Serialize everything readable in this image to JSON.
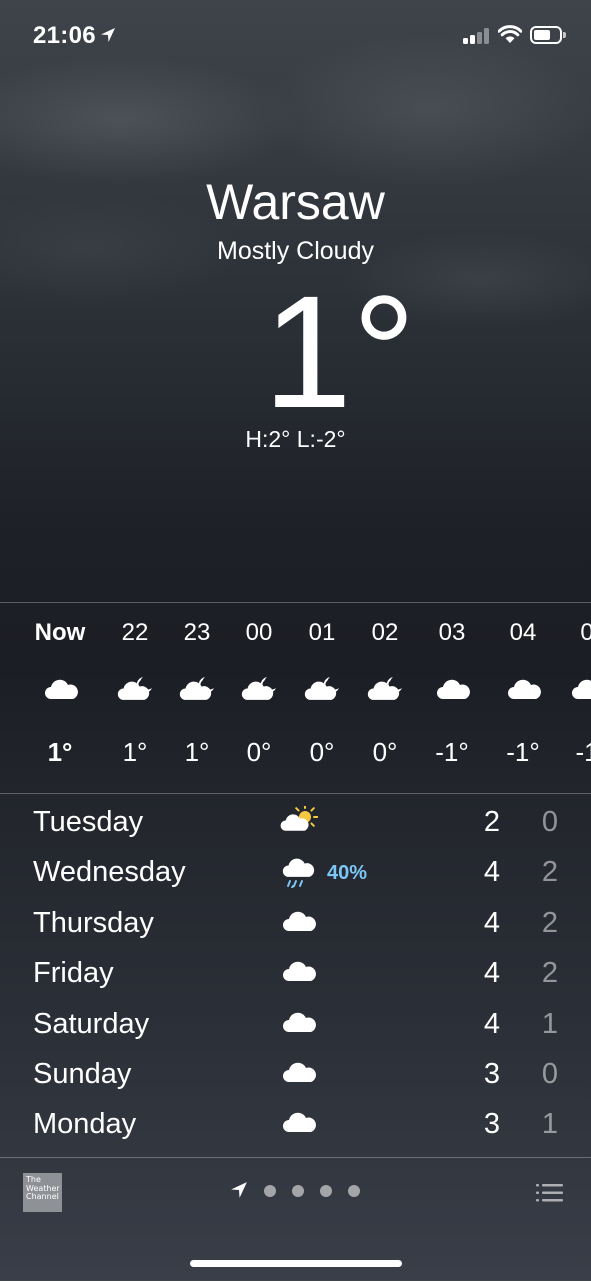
{
  "status_bar": {
    "time": "21:06",
    "icons": [
      "location-arrow-icon",
      "cellular-signal-icon",
      "wifi-icon",
      "battery-icon"
    ]
  },
  "header": {
    "city": "Warsaw",
    "condition": "Mostly Cloudy",
    "temperature": "1°",
    "high_low": "H:2°  L:-2°"
  },
  "hourly": [
    {
      "label": "Now",
      "icon": "cloud-icon",
      "temp": "1°",
      "bold": true
    },
    {
      "label": "22",
      "icon": "cloud-moon-icon",
      "temp": "1°"
    },
    {
      "label": "23",
      "icon": "cloud-moon-icon",
      "temp": "1°"
    },
    {
      "label": "00",
      "icon": "cloud-moon-icon",
      "temp": "0°"
    },
    {
      "label": "01",
      "icon": "cloud-moon-icon",
      "temp": "0°"
    },
    {
      "label": "02",
      "icon": "cloud-moon-icon",
      "temp": "0°"
    },
    {
      "label": "03",
      "icon": "cloud-icon",
      "temp": "-1°"
    },
    {
      "label": "04",
      "icon": "cloud-icon",
      "temp": "-1°"
    },
    {
      "label": "0",
      "icon": "cloud-icon",
      "temp": "-1"
    }
  ],
  "daily": [
    {
      "day": "Tuesday",
      "icon": "sun-cloud-icon",
      "pop": "",
      "high": "2",
      "low": "0"
    },
    {
      "day": "Wednesday",
      "icon": "rain-cloud-icon",
      "pop": "40%",
      "high": "4",
      "low": "2"
    },
    {
      "day": "Thursday",
      "icon": "cloud-icon",
      "pop": "",
      "high": "4",
      "low": "2"
    },
    {
      "day": "Friday",
      "icon": "cloud-icon",
      "pop": "",
      "high": "4",
      "low": "2"
    },
    {
      "day": "Saturday",
      "icon": "cloud-icon",
      "pop": "",
      "high": "4",
      "low": "1"
    },
    {
      "day": "Sunday",
      "icon": "cloud-icon",
      "pop": "",
      "high": "3",
      "low": "0"
    },
    {
      "day": "Monday",
      "icon": "cloud-icon",
      "pop": "",
      "high": "3",
      "low": "1"
    }
  ],
  "bottom_bar": {
    "logo_text": "The Weather Channel",
    "page_dots": 4,
    "list_icon": "list-icon"
  },
  "colors": {
    "precip": "#7cc7f4",
    "sun": "#f5c842"
  }
}
